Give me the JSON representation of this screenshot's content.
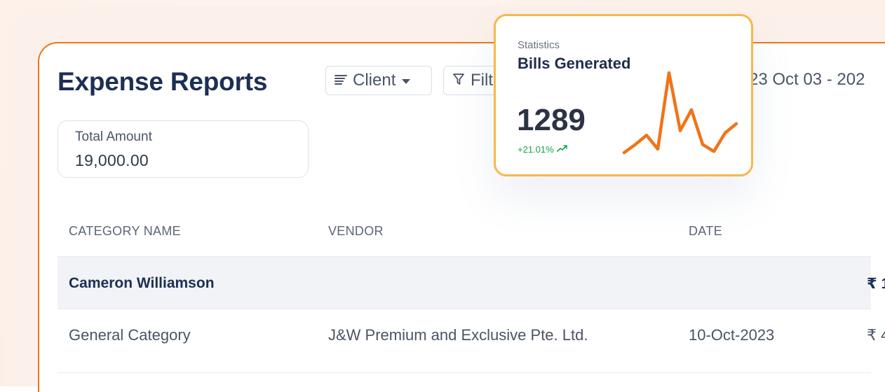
{
  "page": {
    "title": "Expense Reports",
    "client_filter": "Client",
    "filter_label": "Filt",
    "date_range": "23 Oct 03 - 202"
  },
  "total": {
    "label": "Total Amount",
    "value": "19,000.00"
  },
  "table": {
    "headers": [
      "CATEGORY NAME",
      "VENDOR",
      "DATE"
    ],
    "rows": [
      {
        "category": "Cameron Williamson",
        "vendor": "",
        "date": "",
        "amount": "₹ 1"
      },
      {
        "category": "General Category",
        "vendor": "J&W Premium and Exclusive Pte. Ltd.",
        "date": "10-Oct-2023",
        "amount": "₹ 4"
      }
    ]
  },
  "stats": {
    "kicker": "Statistics",
    "title": "Bills Generated",
    "value": "1289",
    "change": "+21.01%",
    "sparkline": [
      3,
      10,
      18,
      6,
      72,
      22,
      40,
      10,
      4,
      20,
      28
    ]
  },
  "colors": {
    "accent": "#e8761f",
    "card_border": "#f5b84a",
    "positive": "#16a34a",
    "title": "#1c2f55"
  },
  "icons": {
    "client": "lines-icon",
    "dropdown": "caret-down-icon",
    "filter": "funnel-icon",
    "trend": "trend-up-icon"
  }
}
